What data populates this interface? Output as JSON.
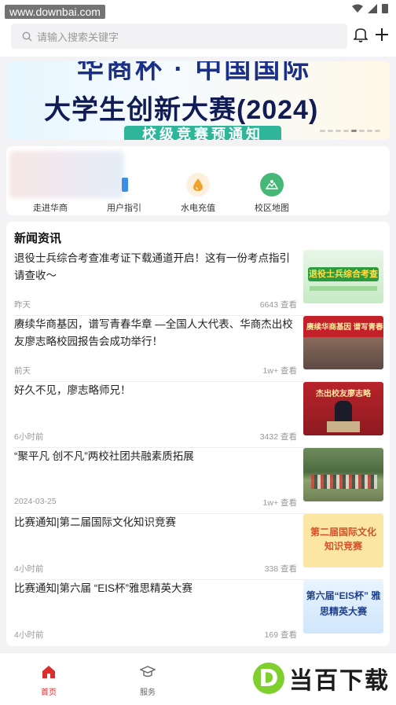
{
  "status": {
    "watermark": "www.downbai.com"
  },
  "search": {
    "placeholder": "请输入搜索关键字"
  },
  "banner": {
    "line1": "华商杯 · 中国国际",
    "line2": "大学生创新大赛(2024)",
    "line3": "校级竞赛预通知"
  },
  "quick": [
    {
      "label": "走进华商",
      "icon": "building-icon",
      "color": "#e46a4f"
    },
    {
      "label": "用户指引",
      "icon": "guide-icon",
      "color": "#3a8ee6"
    },
    {
      "label": "水电充值",
      "icon": "water-drop-icon",
      "color": "#f0a22b"
    },
    {
      "label": "校区地图",
      "icon": "map-icon",
      "color": "#45b878"
    }
  ],
  "news": {
    "title": "新闻资讯",
    "items": [
      {
        "title": "退役士兵综合考查准考证下载通道开启！这有一份考点指引请查收～",
        "date": "昨天",
        "views": "6643 查看",
        "thumb": "退役士兵综合考查"
      },
      {
        "title": "赓续华商基因，谱写青春华章 —全国人大代表、华商杰出校友廖志略校园报告会成功举行！",
        "date": "前天",
        "views": "1w+ 查看",
        "thumb": "赓续华商基因 谱写青春"
      },
      {
        "title": "好久不见，廖志略师兄！",
        "date": "6小时前",
        "views": "3432 查看",
        "thumb": "杰出校友廖志略"
      },
      {
        "title": "“聚平凡 创不凡”两校社团共融素质拓展",
        "date": "2024-03-25",
        "views": "1w+ 查看",
        "thumb": ""
      },
      {
        "title": "比赛通知|第二届国际文化知识竞赛",
        "date": "4小时前",
        "views": "338 查看",
        "thumb": "第二届国际文化 知识竞赛"
      },
      {
        "title": "比赛通知|第六届 “EIS杯”雅思精英大赛",
        "date": "4小时前",
        "views": "169 查看",
        "thumb": "第六届“EIS杯” 雅思精英大赛"
      }
    ]
  },
  "tabs": [
    {
      "label": "首页",
      "active": true
    },
    {
      "label": "服务",
      "active": false
    }
  ],
  "logo_wm": {
    "mark": "D",
    "text": "当百下载"
  },
  "colors": {
    "active": "#d9302f",
    "accent": "#2fb69a"
  }
}
